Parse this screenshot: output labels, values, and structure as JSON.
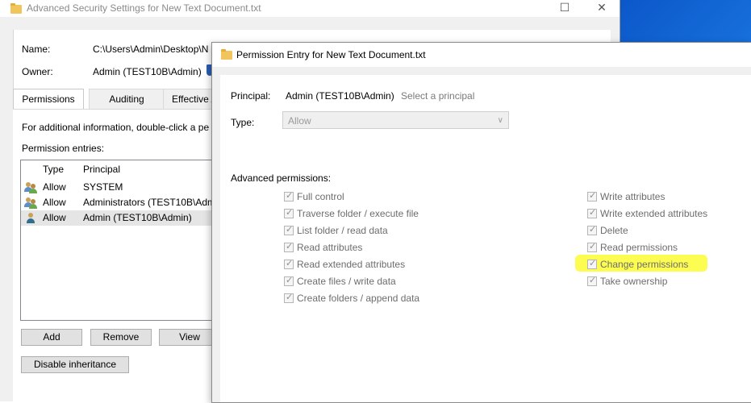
{
  "back_window": {
    "title": "Advanced Security Settings for New Text Document.txt",
    "controls": {
      "maximize": "☐",
      "close": "✕"
    },
    "name_label": "Name:",
    "name_value": "C:\\Users\\Admin\\Desktop\\N",
    "owner_label": "Owner:",
    "owner_value": "Admin (TEST10B\\Admin)",
    "tabs": [
      "Permissions",
      "Auditing",
      "Effective A"
    ],
    "info_text": "For additional information, double-click a pe",
    "entries_label": "Permission entries:",
    "columns": {
      "type": "Type",
      "principal": "Principal"
    },
    "rows": [
      {
        "type": "Allow",
        "principal": "SYSTEM"
      },
      {
        "type": "Allow",
        "principal": "Administrators (TEST10B\\Adm"
      },
      {
        "type": "Allow",
        "principal": "Admin (TEST10B\\Admin)"
      }
    ],
    "buttons": {
      "add": "Add",
      "remove": "Remove",
      "view": "View",
      "disable": "Disable inheritance"
    }
  },
  "dialog": {
    "title": "Permission Entry for New Text Document.txt",
    "principal_label": "Principal:",
    "principal_value": "Admin (TEST10B\\Admin)",
    "select_principal": "Select a principal",
    "type_label": "Type:",
    "type_value": "Allow",
    "adv_label": "Advanced permissions:",
    "left_perms": [
      "Full control",
      "Traverse folder / execute file",
      "List folder / read data",
      "Read attributes",
      "Read extended attributes",
      "Create files / write data",
      "Create folders / append data"
    ],
    "right_perms": [
      "Write attributes",
      "Write extended attributes",
      "Delete",
      "Read permissions",
      "Change permissions",
      "Take ownership"
    ],
    "highlight_color": "#fdfb32"
  }
}
